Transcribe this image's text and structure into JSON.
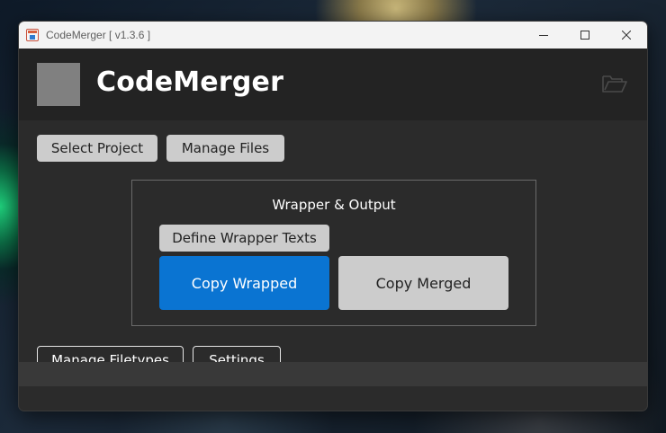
{
  "window": {
    "title": "CodeMerger [ v1.3.6 ]"
  },
  "header": {
    "app_name": "CodeMerger",
    "icons": {
      "folder": "folder-open-icon"
    }
  },
  "toolbar": {
    "select_project": "Select Project",
    "manage_files": "Manage Files"
  },
  "panel": {
    "title": "Wrapper & Output",
    "define_wrapper": "Define Wrapper Texts",
    "copy_wrapped": "Copy Wrapped",
    "copy_merged": "Copy Merged"
  },
  "footer_buttons": {
    "manage_filetypes": "Manage Filetypes",
    "settings": "Settings"
  },
  "colors": {
    "primary": "#0a74d2",
    "light_button": "#cccccc",
    "background": "#2b2b2b",
    "header": "#232323"
  }
}
